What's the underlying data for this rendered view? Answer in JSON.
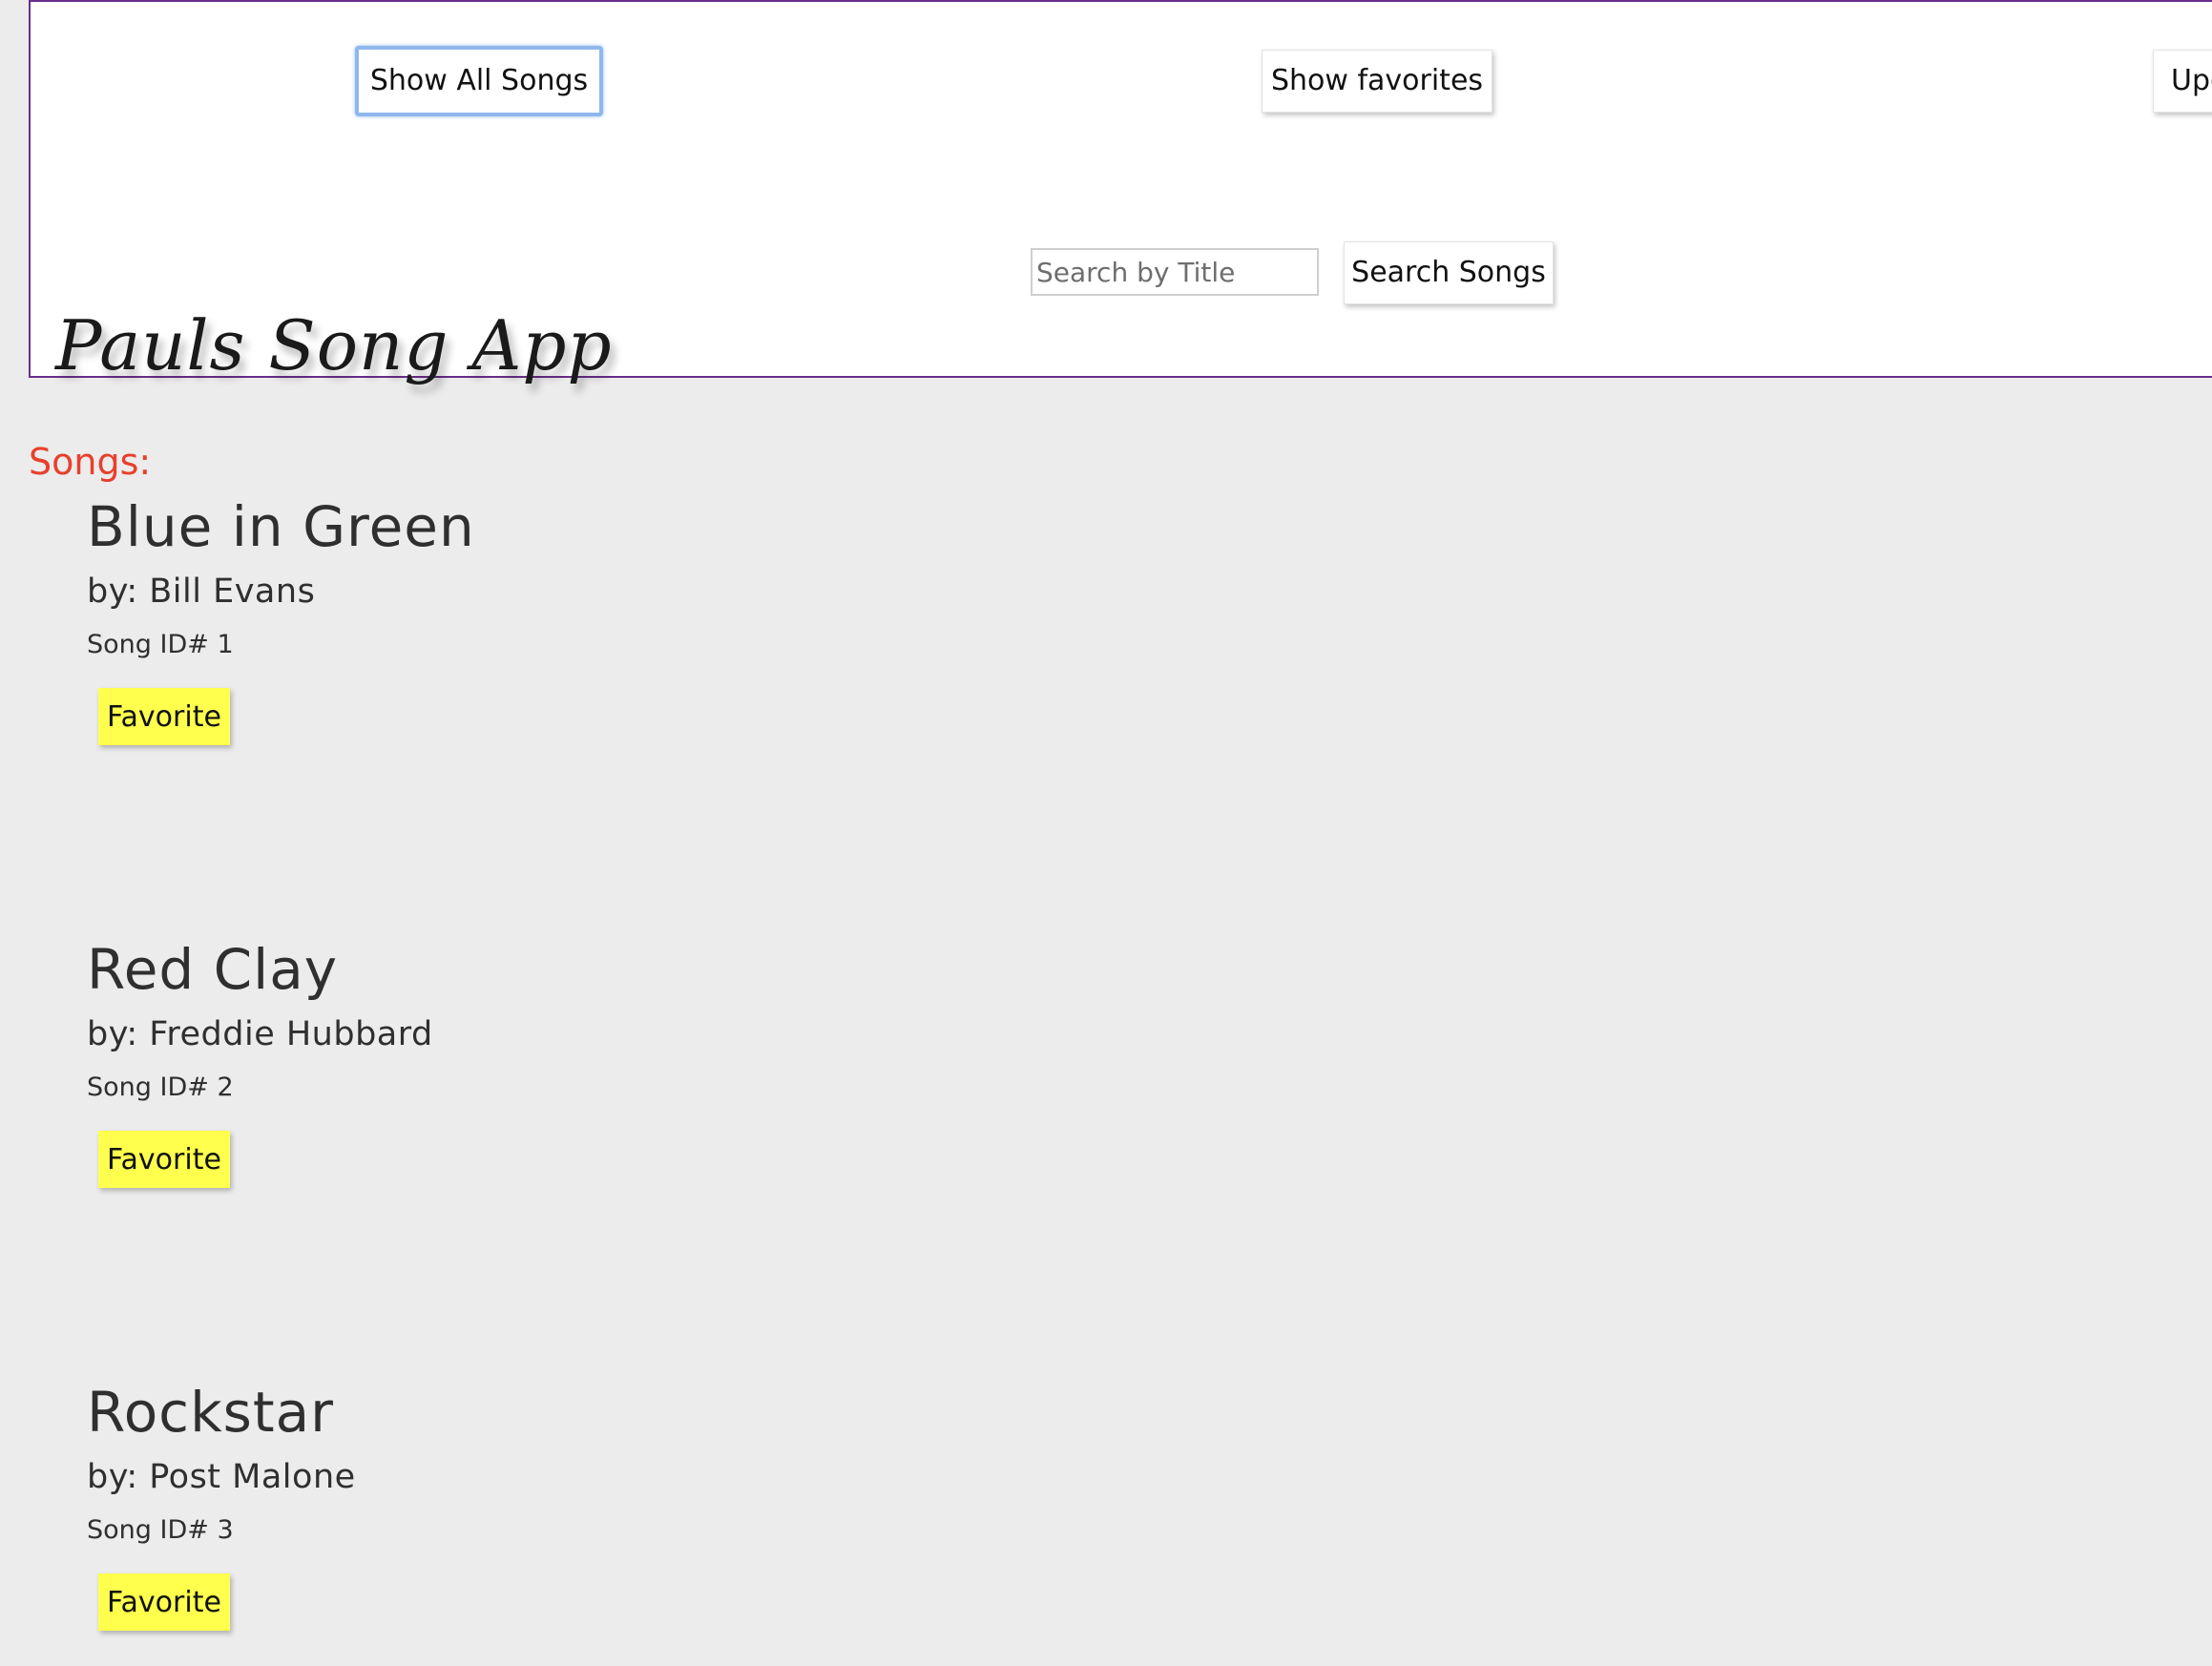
{
  "header": {
    "buttons": {
      "show_all": "Show All Songs",
      "show_favorites": "Show favorites",
      "update": "Upd"
    },
    "search": {
      "placeholder": "Search by Title",
      "button": "Search Songs"
    },
    "app_title": "Pauls Song App"
  },
  "main": {
    "songs_label": "Songs:",
    "songs": [
      {
        "title": "Blue in Green",
        "artist": "by: Bill Evans",
        "id": "Song ID# 1",
        "favorite_label": "Favorite"
      },
      {
        "title": "Red Clay",
        "artist": "by: Freddie Hubbard",
        "id": "Song ID# 2",
        "favorite_label": "Favorite"
      },
      {
        "title": "Rockstar",
        "artist": "by: Post Malone",
        "id": "Song ID# 3",
        "favorite_label": "Favorite"
      }
    ]
  },
  "colors": {
    "page_background": "#ececec",
    "header_border": "#6a2d8a",
    "songs_label": "#e8402c",
    "favorite_button": "#ffff4d",
    "focus_ring": "#8fb7ec"
  }
}
